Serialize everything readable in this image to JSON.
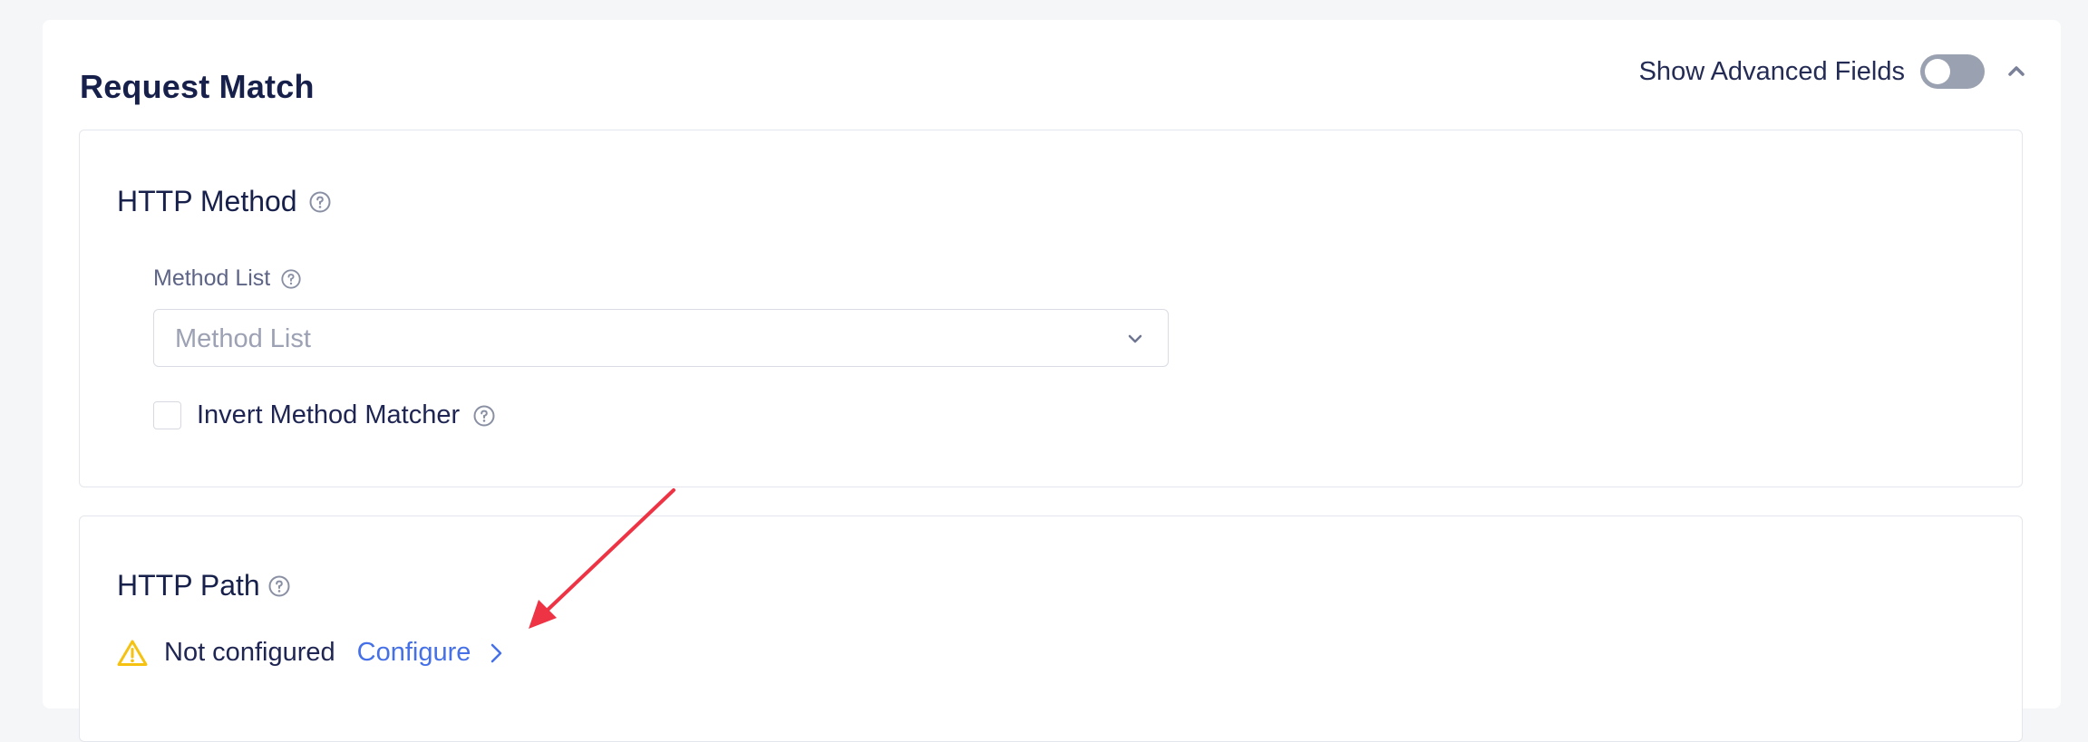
{
  "panel": {
    "title": "Request Match",
    "advanced_label": "Show Advanced Fields",
    "advanced_enabled": false
  },
  "http_method": {
    "title": "HTTP Method",
    "field_label": "Method List",
    "select_placeholder": "Method List",
    "invert_label": "Invert Method Matcher",
    "invert_checked": false
  },
  "http_path": {
    "title": "HTTP Path",
    "status": "Not configured",
    "configure_label": "Configure"
  },
  "colors": {
    "accent": "#4570e8",
    "warning": "#f5c211",
    "annotation_arrow": "#ee3344"
  },
  "icons": [
    "help-icon",
    "chevron-up-icon",
    "chevron-down-icon",
    "warning-icon",
    "chevron-right-icon"
  ]
}
